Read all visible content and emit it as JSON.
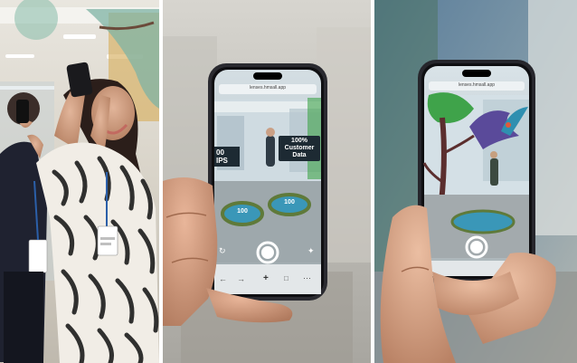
{
  "panels": [
    {
      "id": "panel-1",
      "scene": "office"
    },
    {
      "id": "panel-2",
      "scene": "phone-ar-left",
      "phone_url": "lenses.hmsall.app",
      "ar_label_right_line1": "100%",
      "ar_label_right_line2": "Customer",
      "ar_label_right_line3": "Data",
      "ar_label_left_line1": "00",
      "ar_label_left_line2": "IPS",
      "badge_left": "100",
      "badge_right": "100"
    },
    {
      "id": "panel-3",
      "scene": "phone-ar-right",
      "phone_url": "lenses.hmsall.app"
    }
  ],
  "colors": {
    "divider": "#ffffff",
    "phone_body": "#2a2a30",
    "ar_teal": "#3a97b8",
    "bird_purple": "#5a4a9a",
    "tree_green": "#3fa34a"
  },
  "icons": {
    "capture_button": "capture-button-icon",
    "refresh": "refresh-icon",
    "add": "add-icon",
    "back": "back-arrow-icon",
    "forward": "forward-arrow-icon",
    "share": "share-icon"
  }
}
